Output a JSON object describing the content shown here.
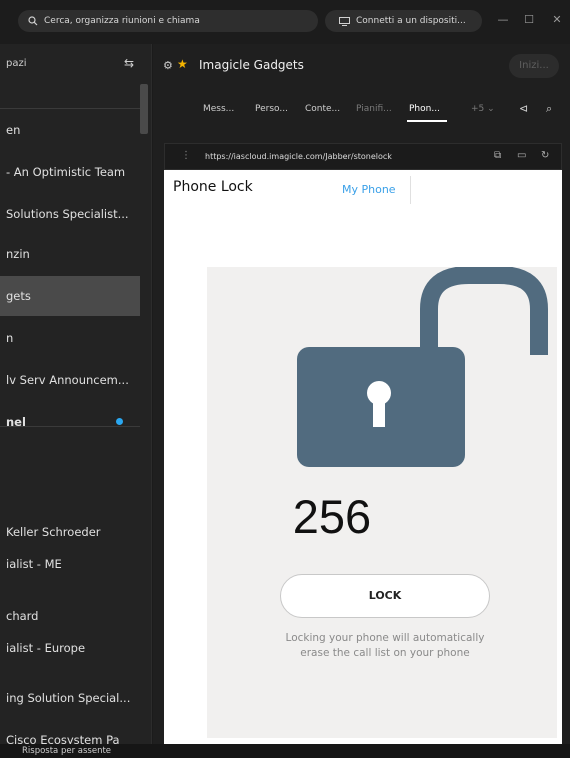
{
  "titlebar": {
    "search_text": "Cerca, organizza riunioni e chiama",
    "connect_text": "Connetti a un dispositi...",
    "minimize": "—",
    "maximize": "☐",
    "close": "✕"
  },
  "sidebar": {
    "header": "pazi",
    "items": [
      {
        "label": "en"
      },
      {
        "label": "- An Optimistic Team"
      },
      {
        "label": "Solutions Specialist..."
      },
      {
        "label": "nzin"
      },
      {
        "label": "gets"
      },
      {
        "label": "n"
      },
      {
        "label": "lv Serv Announcem..."
      }
    ],
    "section": "nel",
    "people": [
      {
        "label": "Keller Schroeder"
      },
      {
        "label": "ialist - ME"
      },
      {
        "label": "chard"
      },
      {
        "label": "ialist - Europe"
      },
      {
        "label": "ing Solution Special..."
      },
      {
        "label": "Cisco Ecosystem Pa"
      }
    ]
  },
  "status_bar": "Risposta per assente",
  "space": {
    "title": "Imagicle Gadgets",
    "start_button": "Inizi...",
    "tabs": [
      "Mess...",
      "Perso...",
      "Conte...",
      "Pianifi...",
      "Phon...",
      "+5 ⌄"
    ]
  },
  "browser": {
    "url": "https://iascloud.imagicle.com/Jabber/stonelock"
  },
  "phone_lock": {
    "title": "Phone Lock",
    "tab_my_phone": "My Phone",
    "counter": "256",
    "lock_button": "LOCK",
    "note": "Locking your phone will automatically erase the call list on your phone"
  },
  "colors": {
    "accent_blue": "#3aa0e8",
    "lock_body": "#516b7f",
    "favorite_star": "#f5b400",
    "unread_dot": "#2aa7f0"
  }
}
